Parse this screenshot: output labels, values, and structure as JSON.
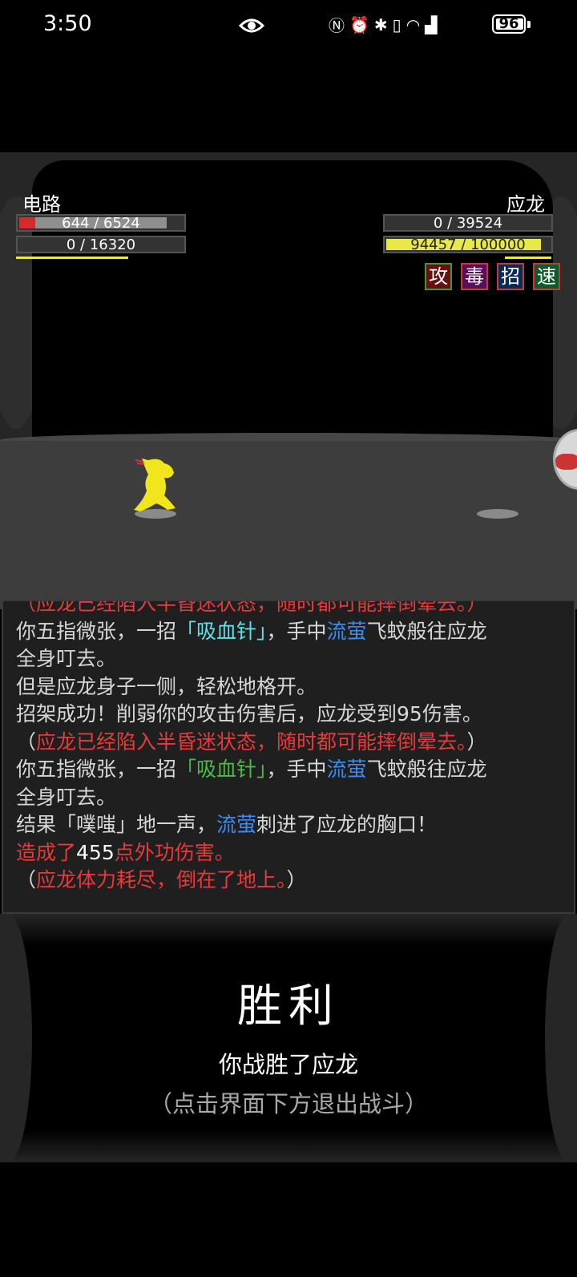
{
  "status_bar": {
    "time": "3:50",
    "battery_level": "96",
    "battery_percent": 96,
    "icons": [
      "eye-icon",
      "nfc-icon",
      "alarm-icon",
      "bluetooth-icon",
      "vibrate-icon",
      "wifi-icon",
      "4g-signal-icon",
      "battery-icon"
    ]
  },
  "player": {
    "name": "电路",
    "hp_text": "644 / 6524",
    "hp_fraction": 0.0987,
    "mp_text": "0 / 16320",
    "mp_fraction": 0
  },
  "enemy": {
    "name": "应龙",
    "hp_text": "0 / 39524",
    "hp_fraction": 0,
    "mp_text": "94457 / 100000",
    "mp_fraction": 0.9446,
    "buffs": [
      {
        "label": "攻",
        "color": "#3c9a3c",
        "bg": "#6a1010"
      },
      {
        "label": "毒",
        "color": "#c03c3c",
        "bg": "#5a1058"
      },
      {
        "label": "招",
        "color": "#c03c3c",
        "bg": "#0c2a58"
      },
      {
        "label": "速",
        "color": "#c03c3c",
        "bg": "#0f5a2a"
      }
    ]
  },
  "colors": {
    "hp_red": "#d42c2c",
    "mp_yellow": "#e8e84a",
    "skill_cyan": "#60e0e8",
    "skill_green": "#4cbb4c",
    "weapon_blue": "#3b8cf0",
    "alert_red": "#e83a3a"
  },
  "combat_log": {
    "cut_line": "（应龙已经陷入半昏迷状态，随时都可能摔倒晕去。）",
    "l1_a": "你五指微张，一招",
    "l1_skill": "「吸血针」",
    "l1_b": "，手中",
    "l1_weapon": "流萤",
    "l1_c": "飞蚊般往应龙",
    "l2": "全身叮去。",
    "l3": "但是应龙身子一侧，轻松地格开。",
    "l4": "招架成功！削弱你的攻击伤害后，应龙受到95伤害。",
    "l5_open": "（",
    "l5_text": "应龙已经陷入半昏迷状态，随时都可能摔倒晕去。",
    "l5_close": "）",
    "l6_a": "你五指微张，一招",
    "l6_skill": "「吸血针」",
    "l6_b": "，手中",
    "l6_weapon": "流萤",
    "l6_c": "飞蚊般往应龙",
    "l7": "全身叮去。",
    "l8_a": "结果「噗嗤」地一声，",
    "l8_weapon": "流萤",
    "l8_b": "刺进了应龙的胸口！",
    "l9_a": "造成了",
    "l9_num": "455",
    "l9_b": "点外功伤害。",
    "l10_open": "（",
    "l10_text": "应龙体力耗尽，倒在了地上。",
    "l10_close": "）"
  },
  "result": {
    "title": "胜利",
    "message": "你战胜了应龙",
    "hint": "（点击界面下方退出战斗）"
  }
}
